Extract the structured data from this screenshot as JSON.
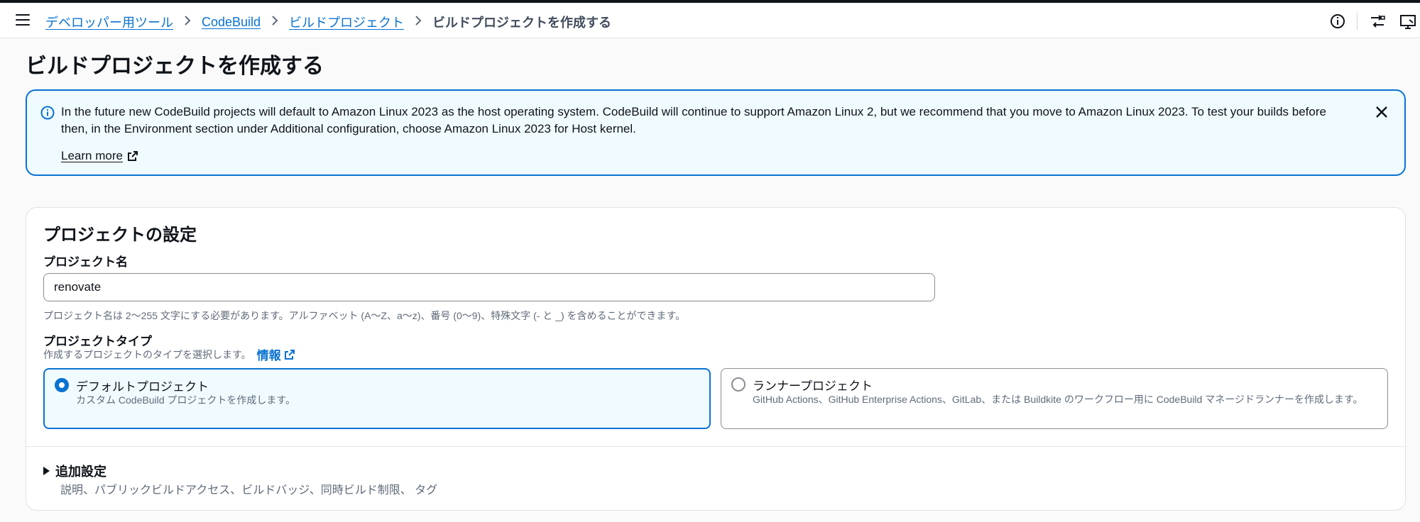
{
  "breadcrumb": {
    "items": [
      "デベロッパー用ツール",
      "CodeBuild",
      "ビルドプロジェクト"
    ],
    "current": "ビルドプロジェクトを作成する"
  },
  "page": {
    "title": "ビルドプロジェクトを作成する"
  },
  "flash": {
    "message": "In the future new CodeBuild projects will default to Amazon Linux 2023 as the host operating system. CodeBuild will continue to support Amazon Linux 2, but we recommend that you move to Amazon Linux 2023. To test your builds before then, in the Environment section under Additional configuration, choose Amazon Linux 2023 for Host kernel.",
    "link": "Learn more"
  },
  "project_settings": {
    "title": "プロジェクトの設定",
    "name_label": "プロジェクト名",
    "name_value": "renovate",
    "name_hint": "プロジェクト名は 2〜255 文字にする必要があります。アルファベット (A〜Z、a〜z)、番号 (0〜9)、特殊文字 (- と _) を含めることができます。",
    "type_label": "プロジェクトタイプ",
    "type_hint": "作成するプロジェクトのタイプを選択します。",
    "info_link": "情報",
    "options": [
      {
        "title": "デフォルトプロジェクト",
        "desc": "カスタム CodeBuild プロジェクトを作成します。",
        "selected": true
      },
      {
        "title": "ランナープロジェクト",
        "desc": "GitHub Actions、GitHub Enterprise Actions、GitLab、または Buildkite のワークフロー用に CodeBuild マネージドランナーを作成します。",
        "selected": false
      }
    ],
    "additional": {
      "title": "追加設定",
      "desc": "説明、パブリックビルドアクセス、ビルドバッジ、同時ビルド制限、 タグ"
    }
  },
  "colors": {
    "accent": "#0972d3",
    "info_bg": "#f0fbff",
    "text": "#0f141a",
    "muted": "#5f6b7a"
  },
  "icons": [
    "menu-icon",
    "chevron-right-icon",
    "info-icon",
    "compare-icon",
    "screen-icon",
    "close-icon",
    "external-link-icon",
    "caret-right-icon"
  ]
}
